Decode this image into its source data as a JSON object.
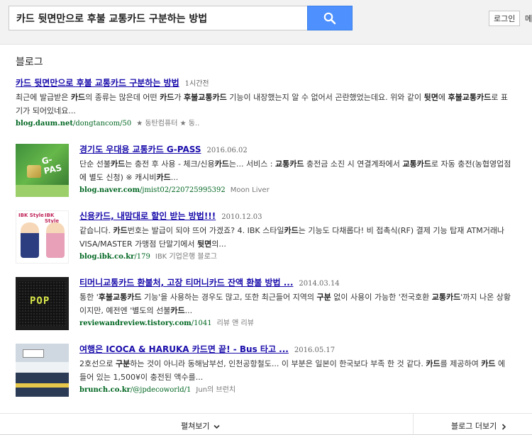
{
  "search": {
    "query": "카드 뒷면만으로 후불 교통카드 구분하는 방법"
  },
  "header": {
    "login_label": "로그인",
    "more_label": "메"
  },
  "section": {
    "title": "블로그"
  },
  "results": [
    {
      "title": "카드 뒷면만으로 후불 교통카드 구분하는 방법",
      "date": "1시간전",
      "snippet_parts": [
        {
          "t": "최근에 발급받은 ",
          "b": false
        },
        {
          "t": "카드",
          "b": true
        },
        {
          "t": "의 종류는 많은데 어떤 ",
          "b": false
        },
        {
          "t": "카드",
          "b": true
        },
        {
          "t": "가 ",
          "b": false
        },
        {
          "t": "후불교통카드",
          "b": true
        },
        {
          "t": " 기능이 내장했는지 알 수 없어서 곤란했었는데요. 위와 같이 ",
          "b": false
        },
        {
          "t": "뒷면",
          "b": true
        },
        {
          "t": "에 ",
          "b": false
        },
        {
          "t": "후불교통카드",
          "b": true
        },
        {
          "t": "로 표기가 되어있네요...",
          "b": false
        }
      ],
      "url_domain": "blog.daum.net",
      "url_path": "/dongtancom/50",
      "source": "★ 동탄컴퓨터 ★ 동.."
    },
    {
      "title": "경기도 우대용 교통카드 G-PASS",
      "date": "2016.06.02",
      "snippet_parts": [
        {
          "t": "단순 선불",
          "b": false
        },
        {
          "t": "카드",
          "b": true
        },
        {
          "t": "는 충전 후 사용 - 체크/신용",
          "b": false
        },
        {
          "t": "카드",
          "b": true
        },
        {
          "t": "는... 서비스 : ",
          "b": false
        },
        {
          "t": "교통카드",
          "b": true
        },
        {
          "t": " 충전금 소진 시 연결계좌에서 ",
          "b": false
        },
        {
          "t": "교통카드",
          "b": true
        },
        {
          "t": "로 자동 충전(농협영업점에 별도 신청) ※ 캐시비",
          "b": false
        },
        {
          "t": "카드",
          "b": true
        },
        {
          "t": "...",
          "b": false
        }
      ],
      "url_domain": "blog.naver.com",
      "url_path": "/jmist02/220725995392",
      "source": "Moon Liver"
    },
    {
      "title": "신용카드, 내맘대로 할인 받는 방법!!!",
      "date": "2010.12.03",
      "snippet_parts": [
        {
          "t": "같습니다. ",
          "b": false
        },
        {
          "t": "카드",
          "b": true
        },
        {
          "t": "번호는 발급이 되야 뜨어 가겠죠? 4. IBK 스타일",
          "b": false
        },
        {
          "t": "카드",
          "b": true
        },
        {
          "t": "는 기능도 다채롭다! 비 접촉식(RF) 결제 기능 탑재 ATM거래나 VISA/MASTER 가맹점 단말기에서 ",
          "b": false
        },
        {
          "t": "뒷면",
          "b": true
        },
        {
          "t": "의...",
          "b": false
        }
      ],
      "url_domain": "blog.ibk.co.kr",
      "url_path": "/179",
      "source": "IBK 기업은행 블로그"
    },
    {
      "title": "티머니교통카드 환불처, 고장 티머니카드 잔액 환불 방법 ...",
      "date": "2014.03.14",
      "snippet_parts": [
        {
          "t": "통한 '",
          "b": false
        },
        {
          "t": "후불교통카드",
          "b": true
        },
        {
          "t": " 기능'을 사용하는 경우도 많고, 또한 최근들어 지역의 ",
          "b": false
        },
        {
          "t": "구분",
          "b": true
        },
        {
          "t": " 없이 사용이 가능한 '전국호환 ",
          "b": false
        },
        {
          "t": "교통카드",
          "b": true
        },
        {
          "t": "'까지 나온 상황이지만, 예전엔 '별도의 선불",
          "b": false
        },
        {
          "t": "카드",
          "b": true
        },
        {
          "t": "...",
          "b": false
        }
      ],
      "url_domain": "reviewandreview.tistory.com",
      "url_path": "/1041",
      "source": "리뷰 앤 리뷰"
    },
    {
      "title": "여행은 ICOCA & HARUKA 카드면 끝! - Bus 타고 ...",
      "date": "2016.05.17",
      "snippet_parts": [
        {
          "t": "2호선으로 ",
          "b": false
        },
        {
          "t": "구분",
          "b": true
        },
        {
          "t": "하는 것이 아니라 동해남부선, 인천공항철도... 이 부분은 일본이 한국보다 부족 한 것 같다. ",
          "b": false
        },
        {
          "t": "카드",
          "b": true
        },
        {
          "t": "를 제공하여 ",
          "b": false
        },
        {
          "t": "카드",
          "b": true
        },
        {
          "t": " 에 들어 있는 1,500¥이 충전된 액수를...",
          "b": false
        }
      ],
      "url_domain": "brunch.co.kr",
      "url_path": "/@jpdecoworld/1",
      "source": "Jun의 브런치"
    }
  ],
  "thumbs": {
    "gpass_label": "G-PAS",
    "ibk_label_1": "IBK Style",
    "ibk_label_2": "IBK Style",
    "tmoney_label": "POP"
  },
  "footer": {
    "expand_label": "펼쳐보기",
    "more_blog_label": "블로그 더보기"
  }
}
